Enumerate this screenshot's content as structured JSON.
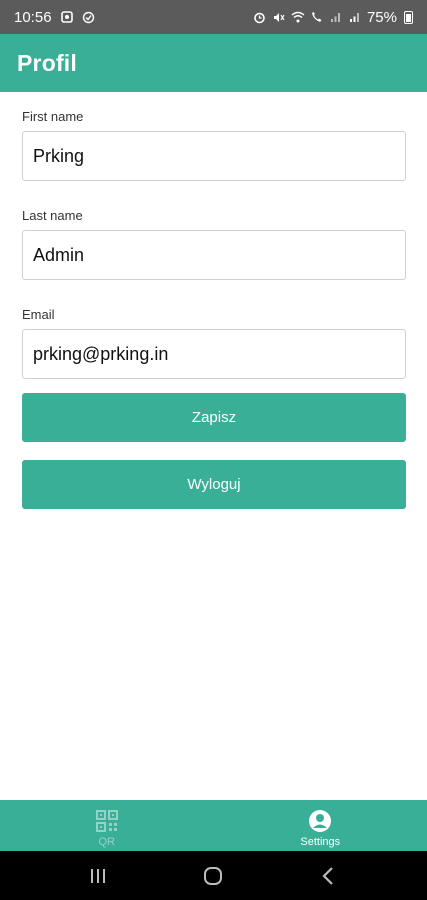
{
  "status_bar": {
    "time": "10:56",
    "battery_percent": "75%",
    "left_icons": [
      "gallery-icon",
      "sync-icon"
    ],
    "right_icons": [
      "alarm-icon",
      "mute-icon",
      "wifi-icon",
      "wifi-calling-icon",
      "signal-icon",
      "signal-icon",
      "battery-icon"
    ]
  },
  "app_bar": {
    "title": "Profil"
  },
  "form": {
    "first_name": {
      "label": "First name",
      "value": "Prking"
    },
    "last_name": {
      "label": "Last name",
      "value": "Admin"
    },
    "email": {
      "label": "Email",
      "value": "prking@prking.in"
    }
  },
  "buttons": {
    "save": "Zapisz",
    "logout": "Wyloguj"
  },
  "bottom_nav": {
    "items": [
      {
        "label": "QR",
        "icon": "qr-code-icon",
        "active": false
      },
      {
        "label": "Settings",
        "icon": "account-circle-icon",
        "active": true
      }
    ]
  },
  "system_nav": {
    "icons": [
      "recent-apps-icon",
      "home-icon",
      "back-icon"
    ]
  },
  "colors": {
    "accent": "#3aaf97",
    "status_bar": "#5b5b5b",
    "system_nav": "#000000"
  }
}
